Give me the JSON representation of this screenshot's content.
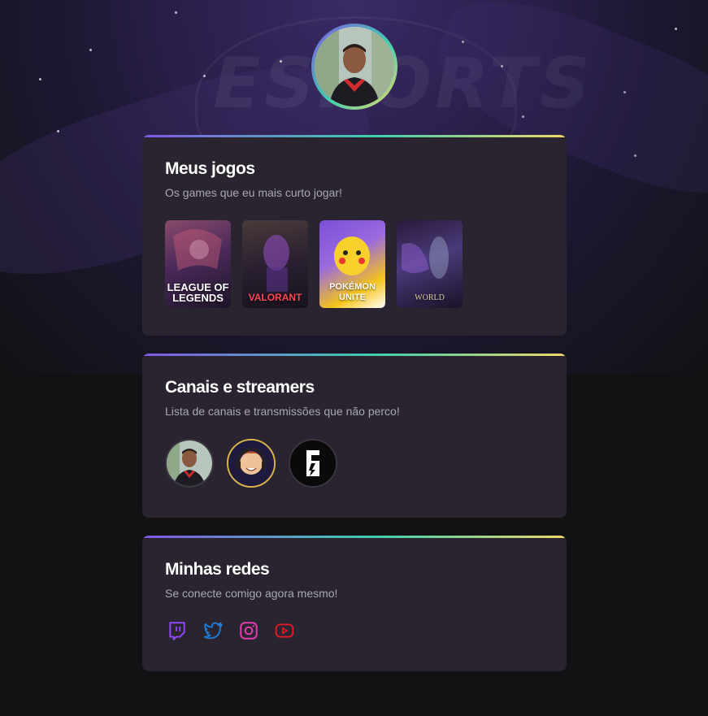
{
  "profile": {
    "avatar_alt": "profile-photo"
  },
  "sections": {
    "games": {
      "title": "Meus jogos",
      "subtitle": "Os games que eu mais curto jogar!",
      "items": [
        {
          "label": "LEAGUE OF LEGENDS",
          "colors": [
            "#5a3a7a",
            "#2a1a3a"
          ]
        },
        {
          "label": "VALORANT",
          "colors": [
            "#3a2a4a",
            "#1a1420"
          ]
        },
        {
          "label": "POKÉMON UNITE",
          "colors": [
            "#7b4fd6",
            "#f5c518"
          ]
        },
        {
          "label": "WORLD",
          "colors": [
            "#3a2a5a",
            "#1a1228"
          ]
        }
      ]
    },
    "channels": {
      "title": "Canais e streamers",
      "subtitle": "Lista de canais e transmissões que não perco!",
      "items": [
        {
          "name": "channel-1"
        },
        {
          "name": "channel-2"
        },
        {
          "name": "channel-3"
        }
      ]
    },
    "socials": {
      "title": "Minhas redes",
      "subtitle": "Se conecte comigo agora mesmo!",
      "items": [
        {
          "icon": "twitch-icon",
          "color": "#9146ff"
        },
        {
          "icon": "twitter-icon",
          "color": "#1f7bd6"
        },
        {
          "icon": "instagram-icon",
          "color": "#e23fb0"
        },
        {
          "icon": "youtube-icon",
          "color": "#e3192a"
        }
      ]
    }
  },
  "colors": {
    "page_bg": "#121214",
    "card_bg": "#29242f",
    "gradient": [
      "#8257e5",
      "#3ecfae",
      "#f0d86a"
    ],
    "title": "#ffffff",
    "subtitle": "#a8a8b3"
  }
}
